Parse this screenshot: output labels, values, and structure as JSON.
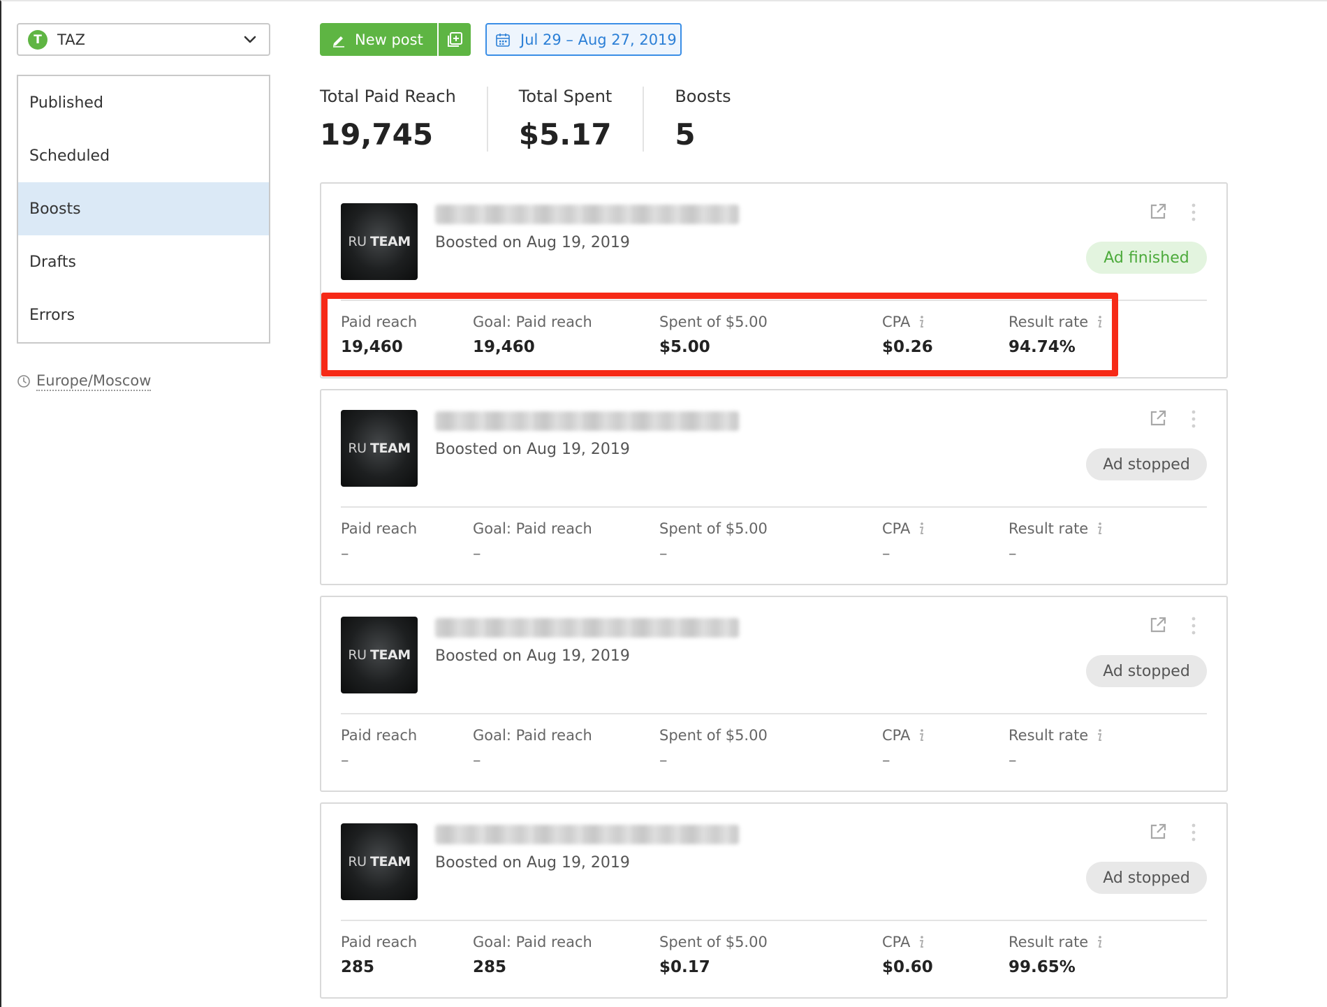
{
  "colors": {
    "accent_green": "#5eb543",
    "accent_blue": "#3a8ee6",
    "nav_active_bg": "#dbe9f6",
    "status_finished_bg": "#e3f4df",
    "status_finished_text": "#4caa3b",
    "status_stopped_bg": "#e8e8e8",
    "highlight_red": "#f62a17"
  },
  "project": {
    "avatar_letter": "T",
    "name": "TAZ",
    "chevron_icon": "chevron-down-icon"
  },
  "nav": {
    "items": [
      {
        "label": "Published"
      },
      {
        "label": "Scheduled"
      },
      {
        "label": "Boosts",
        "active": true
      },
      {
        "label": "Drafts"
      },
      {
        "label": "Errors"
      }
    ]
  },
  "timezone": {
    "icon": "clock-icon",
    "label": "Europe/Moscow"
  },
  "toolbar": {
    "new_post_icon": "pencil-icon",
    "new_post_label": "New post",
    "extra_icon": "add-copy-icon",
    "date_icon": "calendar-icon",
    "date_range": "Jul 29 – Aug 27, 2019"
  },
  "summary": {
    "total_paid_reach": {
      "label": "Total Paid Reach",
      "value": "19,745"
    },
    "total_spent": {
      "label": "Total Spent",
      "value": "$5.17"
    },
    "boosts": {
      "label": "Boosts",
      "value": "5"
    }
  },
  "metric_labels": {
    "paid_reach": "Paid reach",
    "goal": "Goal: Paid reach",
    "spent": "Spent of $5.00",
    "cpa": "CPA",
    "result_rate": "Result rate"
  },
  "cards": [
    {
      "thumb_prefix": "RU",
      "thumb_brand": "TEAM",
      "boosted_on": "Boosted on Aug 19, 2019",
      "status": "Ad finished",
      "status_kind": "finished",
      "paid_reach": "19,460",
      "goal": "19,460",
      "spent": "$5.00",
      "cpa": "$0.26",
      "result_rate": "94.74%"
    },
    {
      "thumb_prefix": "RU",
      "thumb_brand": "TEAM",
      "boosted_on": "Boosted on Aug 19, 2019",
      "status": "Ad stopped",
      "status_kind": "stopped",
      "paid_reach": "–",
      "goal": "–",
      "spent": "–",
      "cpa": "–",
      "result_rate": "–"
    },
    {
      "thumb_prefix": "RU",
      "thumb_brand": "TEAM",
      "boosted_on": "Boosted on Aug 19, 2019",
      "status": "Ad stopped",
      "status_kind": "stopped",
      "paid_reach": "–",
      "goal": "–",
      "spent": "–",
      "cpa": "–",
      "result_rate": "–"
    },
    {
      "thumb_prefix": "RU",
      "thumb_brand": "TEAM",
      "boosted_on": "Boosted on Aug 19, 2019",
      "status": "Ad stopped",
      "status_kind": "stopped",
      "paid_reach": "285",
      "goal": "285",
      "spent": "$0.17",
      "cpa": "$0.60",
      "result_rate": "99.65%"
    }
  ]
}
